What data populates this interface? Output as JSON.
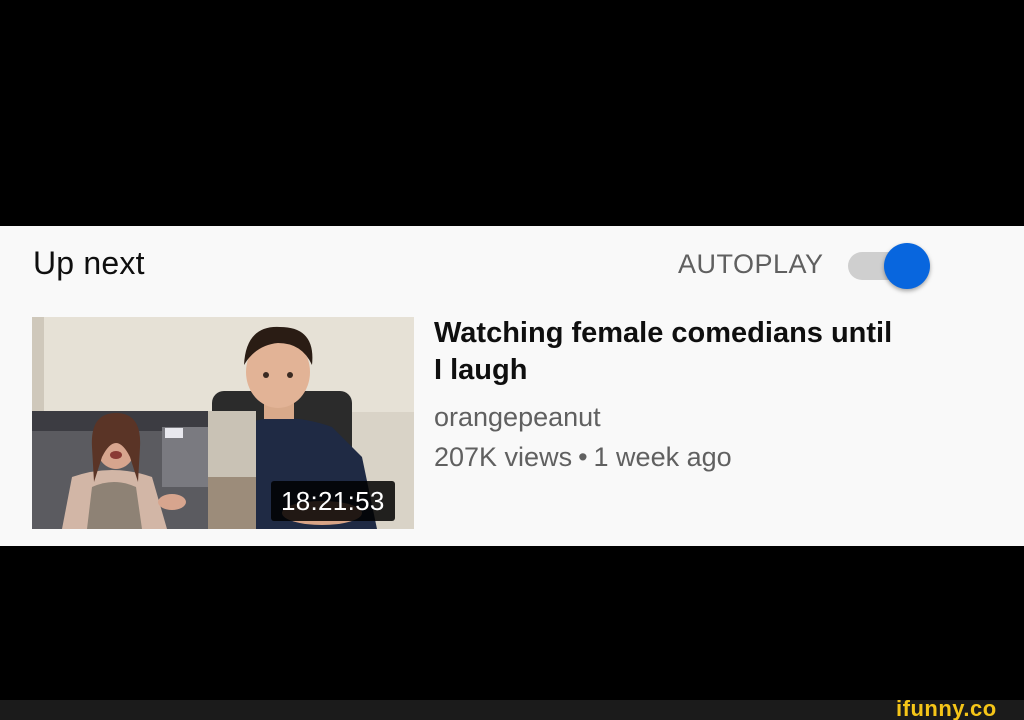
{
  "up_next": {
    "label": "Up next",
    "autoplay_label": "AUTOPLAY",
    "autoplay_enabled": true
  },
  "video": {
    "title": "Watching female comedians until I laugh",
    "channel": "orangepeanut",
    "views": "207K views",
    "separator": "•",
    "age": "1 week ago",
    "duration": "18:21:53"
  },
  "watermark": "ifunny.co",
  "colors": {
    "panel_bg": "#f9f9f9",
    "toggle_knob": "#0866de",
    "toggle_track": "#cfcfcf",
    "secondary_text": "#606060",
    "watermark": "#f5c518"
  }
}
